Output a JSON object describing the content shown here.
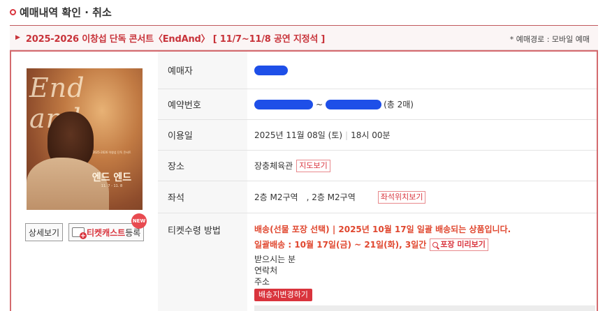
{
  "page": {
    "title": "예매내역 확인 · 취소"
  },
  "event": {
    "title": "2025-2026 이창섭 단독 콘서트〈EndAnd〉 [ 11/7~11/8 공연 지정석 ]",
    "route": "* 예매경로 : 모바일 예매"
  },
  "poster": {
    "script_text": "End and",
    "title_ko": "엔드 엔드",
    "subtitle": "2025-2026 이창섭 단독 콘서트",
    "date_text": "11. 7 - 11. 8"
  },
  "buttons": {
    "detail": "상세보기",
    "ticketcast": "티켓캐스트",
    "ticketcast_suffix": "등록",
    "new_badge": "NEW"
  },
  "info": {
    "booker_label": "예매자",
    "booking_no_label": "예약번호",
    "booking_no_mid": "~",
    "booking_no_suffix": "(총 2매)",
    "date_label": "이용일",
    "date_value": "2025년 11월 08일 (토)",
    "time_value": "18시 00분",
    "venue_label": "장소",
    "venue_value": "장충체육관",
    "map_button": "지도보기",
    "seat_label": "좌석",
    "seat_1": "2층 M2구역",
    "seat_2": ", 2층 M2구역",
    "seat_map_button": "좌석위치보기",
    "pickup_label": "티켓수령 방법",
    "delivery_line1": "배송(선물 포장 선택) | 2025년 10월 17일 일괄 배송되는 상품입니다.",
    "delivery_line2": "일괄배송 : 10월 17일(금) ~ 21일(화), 3일간",
    "preview_button": "포장 미리보기",
    "recipient_label": "받으시는 분",
    "contact_label": "연락처",
    "address_label": "주소",
    "change_address_button": "배송지변경하기"
  },
  "colors": {
    "accent": "#d9343d",
    "redaction": "#1e4fe8",
    "delivery_text": "#e0472f"
  }
}
